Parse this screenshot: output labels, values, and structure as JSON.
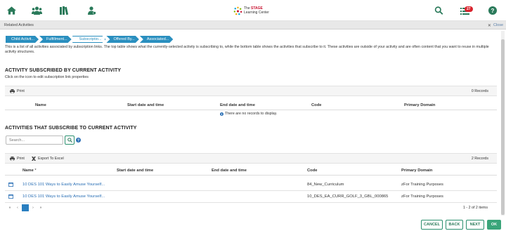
{
  "header": {
    "logo_line1_prefix": "The ",
    "logo_line1_brand": "STAGE",
    "logo_line2": "Learning Center",
    "notification_count": "27",
    "brand_color": "#2a7a5a"
  },
  "related": {
    "title": "Related Activities",
    "close_label": "Close"
  },
  "steps": [
    "Child Activit...",
    "Fulfillment...",
    "Subscriptio...",
    "Offered By...",
    "Associated..."
  ],
  "intro_text": "This is a list of all activities associated by subscription links. The top table shows what the currently-selected activity is subscribing to, while the bottom table shows the activities that subscribe to it. These activities are outside of your activity and are often content that you want to reuse in multiple activity structures.",
  "subscribed": {
    "title": "ACTIVITY SUBSCRIBED BY CURRENT ACTIVITY",
    "subtitle": "Click on the icon to edit subscription link properties",
    "print_label": "Print",
    "records": "0 Records",
    "columns": [
      "Name",
      "Start date and time",
      "End date and time",
      "Code",
      "Primary Domain"
    ],
    "empty_message": "There are no records to display."
  },
  "subscribers": {
    "title": "ACTIVITIES THAT SUBSCRIBE TO CURRENT ACTIVITY",
    "search_placeholder": "Search...",
    "print_label": "Print",
    "export_label": "Export To Excel",
    "records": "2 Records",
    "columns": [
      "Name",
      "Start date and time",
      "End date and time",
      "Code",
      "Primary Domain"
    ],
    "name_sort_marker": "*",
    "rows": [
      {
        "name": "10 DES 101 Ways to Easily Amuse Yourself...",
        "start": "",
        "end": "",
        "code": "84_New_Curriculum",
        "domain": "zFor Training Purposes"
      },
      {
        "name": "10 DES 101 Ways to Easily Amuse Yourself...",
        "start": "",
        "end": "",
        "code": "10_DES_EA_CURR_GOLF_3_GBL_000865",
        "domain": "zFor Training Purposes"
      }
    ],
    "pager": {
      "first": "«",
      "prev": "‹",
      "current": "1",
      "next": "›",
      "last": "»"
    },
    "items_info": "1 - 2 of 2 items"
  },
  "footer": {
    "cancel": "CANCEL",
    "back": "BACK",
    "next": "NEXT",
    "ok": "OK"
  }
}
